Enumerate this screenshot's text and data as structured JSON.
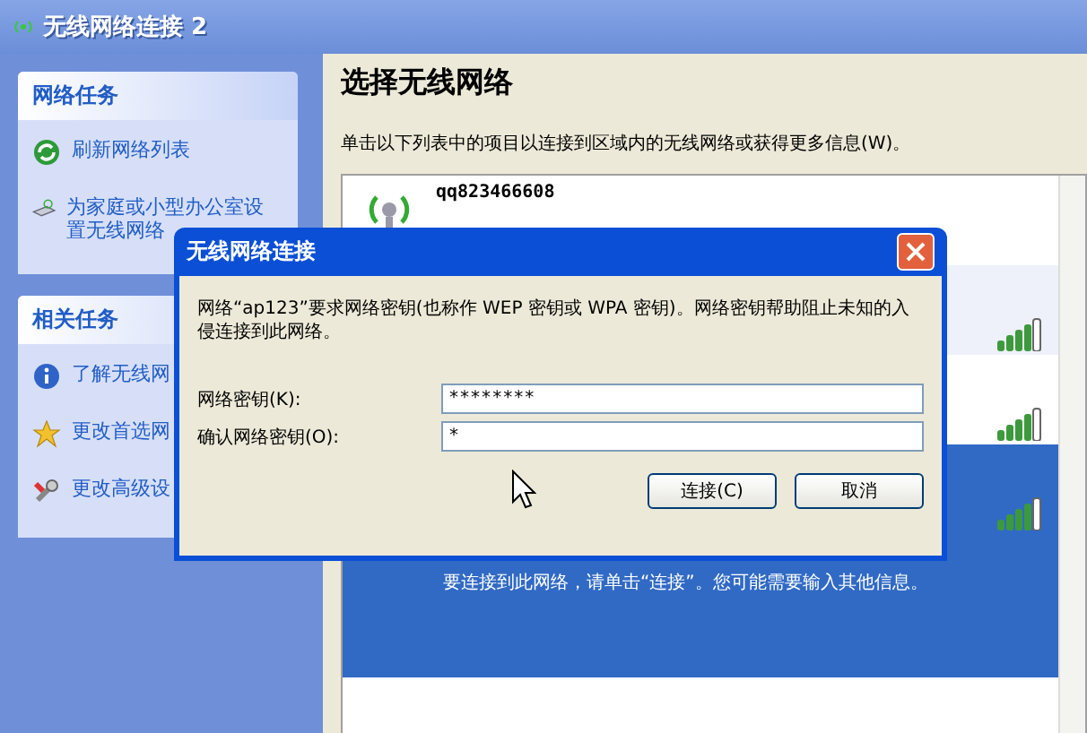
{
  "window": {
    "title": "无线网络连接 2"
  },
  "task_panels": [
    {
      "title": "网络任务",
      "items": [
        {
          "label": "刷新网络列表"
        },
        {
          "label": "为家庭或小型办公室设置无线网络"
        }
      ]
    },
    {
      "title": "相关任务",
      "items": [
        {
          "label": "了解无线网"
        },
        {
          "label": "更改首选网"
        },
        {
          "label": "更改高级设"
        }
      ]
    }
  ],
  "main": {
    "heading": "选择无线网络",
    "instruction": "单击以下列表中的项目以连接到区域内的无线网络或获得更多信息(W)。"
  },
  "networks": [
    {
      "name": "qq823466608",
      "selected": false
    },
    {
      "selected": false
    },
    {
      "selected": false
    },
    {
      "selected": true,
      "message": "要连接到此网络，请单击“连接”。您可能需要输入其他信息。"
    }
  ],
  "dialog": {
    "title": "无线网络连接",
    "message": "网络“ap123”要求网络密钥(也称作 WEP 密钥或 WPA 密钥)。网络密钥帮助阻止未知的入侵连接到此网络。",
    "fields": [
      {
        "label": "网络密钥(K):",
        "value": "********"
      },
      {
        "label": "确认网络密钥(O):",
        "value": "*"
      }
    ],
    "buttons": [
      "连接(C)",
      "取消"
    ]
  }
}
